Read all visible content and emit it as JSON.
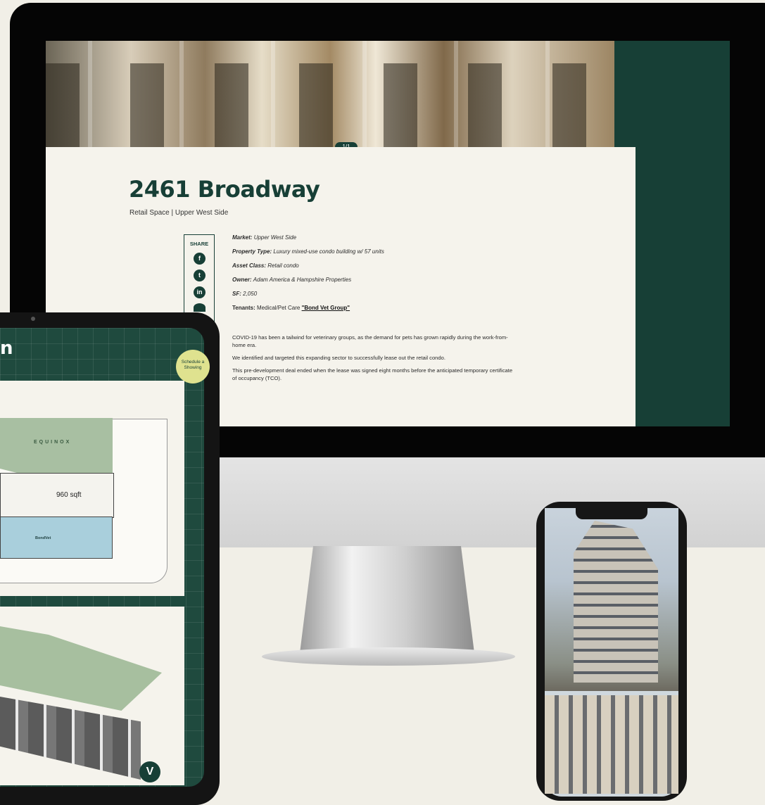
{
  "hero": {
    "counter": "1/1"
  },
  "property": {
    "title": "2461 Broadway",
    "subtitle": "Retail Space | Upper West Side"
  },
  "share": {
    "label": "SHARE",
    "icons": [
      "facebook-icon",
      "twitter-icon",
      "linkedin-icon",
      "instagram-icon"
    ]
  },
  "facts": [
    {
      "label": "Market:",
      "value": "Upper West Side"
    },
    {
      "label": "Property Type:",
      "value": "Luxury mixed-use condo building w/ 57 units"
    },
    {
      "label": "Asset Class:",
      "value": "Retail condo"
    },
    {
      "label": "Owner:",
      "value": "Adam America & Hampshire Properties"
    },
    {
      "label": "SF:",
      "value": "2,050"
    },
    {
      "label": "Tenants:",
      "value": "Medical/Pet Care",
      "link": "\"Bond Vet Group\""
    }
  ],
  "body": [
    "COVID-19 has been a tailwind for veterinary groups, as the demand for pets has grown rapidly during the work-from-home era.",
    "We identified and targeted this expanding sector to successfully lease out the retail condo.",
    "This pre-development deal ended when the lease was signed eight months before the anticipated temporary certificate of occupancy (TCO)."
  ],
  "tablet": {
    "title_fragment": "n",
    "schedule_button": "Schedule a Showing",
    "plan": {
      "equinox": "EQUINOX",
      "sqft": "960 sqft",
      "bondvet": "BondVet"
    },
    "logo": "V"
  },
  "colors": {
    "brand": "#173f36",
    "accent": "#dfe28f",
    "paper": "#f5f3ec"
  }
}
